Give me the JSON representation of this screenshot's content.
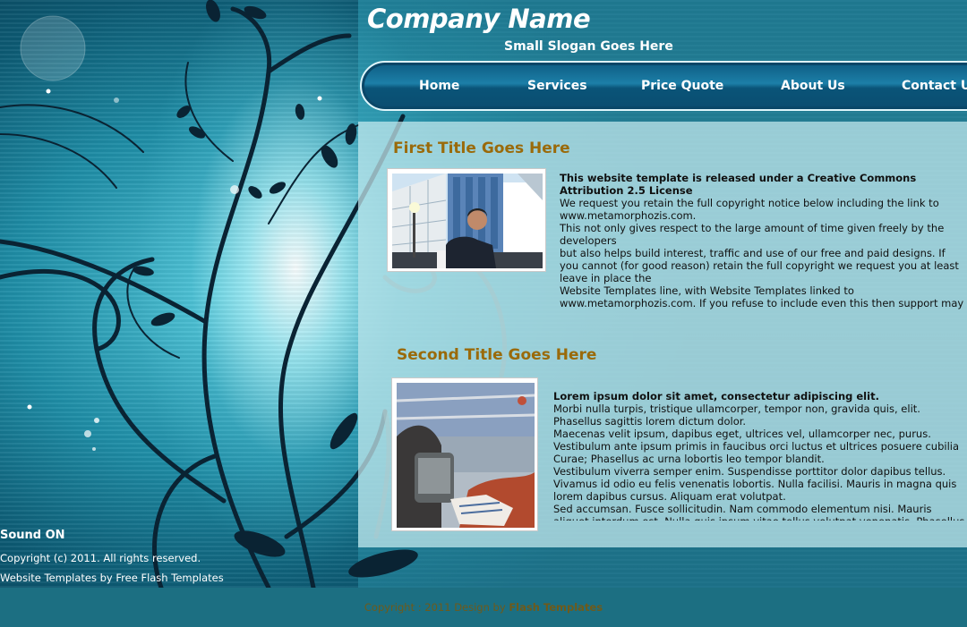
{
  "header": {
    "company_name": "Company Name",
    "slogan": "Small Slogan Goes Here"
  },
  "nav": {
    "items": [
      {
        "label": "Home"
      },
      {
        "label": "Services"
      },
      {
        "label": "Price Quote"
      },
      {
        "label": "About Us"
      },
      {
        "label": "Contact Us"
      }
    ]
  },
  "section1": {
    "title": "First Title Goes Here",
    "lead": "This website template is released under  a Creative Commons Attribution 2.5 License",
    "lines": [
      "We request you retain the full copyright notice below including the link to www.metamorphozis.com.",
      "This not only gives respect to the large amount of time given freely by the developers",
      "but also helps build interest, traffic and use of our free and paid designs. If you cannot (for good reason) retain the full copyright we request you at least leave in place the",
      "Website Templates line, with Website Templates  linked to www.metamorphozis.com. If you refuse to include even this then support may be affected."
    ]
  },
  "section2": {
    "title": "Second Title Goes Here",
    "lead": "Lorem ipsum dolor sit amet, consectetur adipiscing elit.",
    "lines": [
      "Morbi nulla turpis, tristique ullamcorper, tempor non, gravida quis, elit. Phasellus sagittis lorem dictum dolor.",
      "Maecenas velit ipsum, dapibus eget, ultrices vel, ullamcorper nec, purus.",
      "Vestibulum ante ipsum primis in faucibus orci luctus et ultrices posuere cubilia Curae; Phasellus ac urna lobortis leo tempor blandit.",
      "Vestibulum viverra semper enim. Suspendisse porttitor dolor dapibus tellus.",
      "Vivamus id odio eu felis venenatis lobortis. Nulla facilisi. Mauris in magna quis lorem dapibus cursus. Aliquam erat volutpat.",
      "Sed accumsan. Fusce sollicitudin. Nam commodo elementum nisi. Mauris aliquet interdum est. Nulla quis ipsum vitae tellus volutpat venenatis. Phasellus nec"
    ]
  },
  "left_panel": {
    "sound_label": "Sound ON",
    "copyright": "Copyright (c) 2011. All rights reserved.",
    "credits_prefix": "Website Templates  by ",
    "credits_link": "Free Flash Templates"
  },
  "footer": {
    "text": "Copyright : 2011  Design by ",
    "link": "Flash Templates"
  },
  "colors": {
    "section_title": "#9a6a0a",
    "footer_bg": "#1c6f82",
    "nav_bg": "#0e5c82"
  }
}
